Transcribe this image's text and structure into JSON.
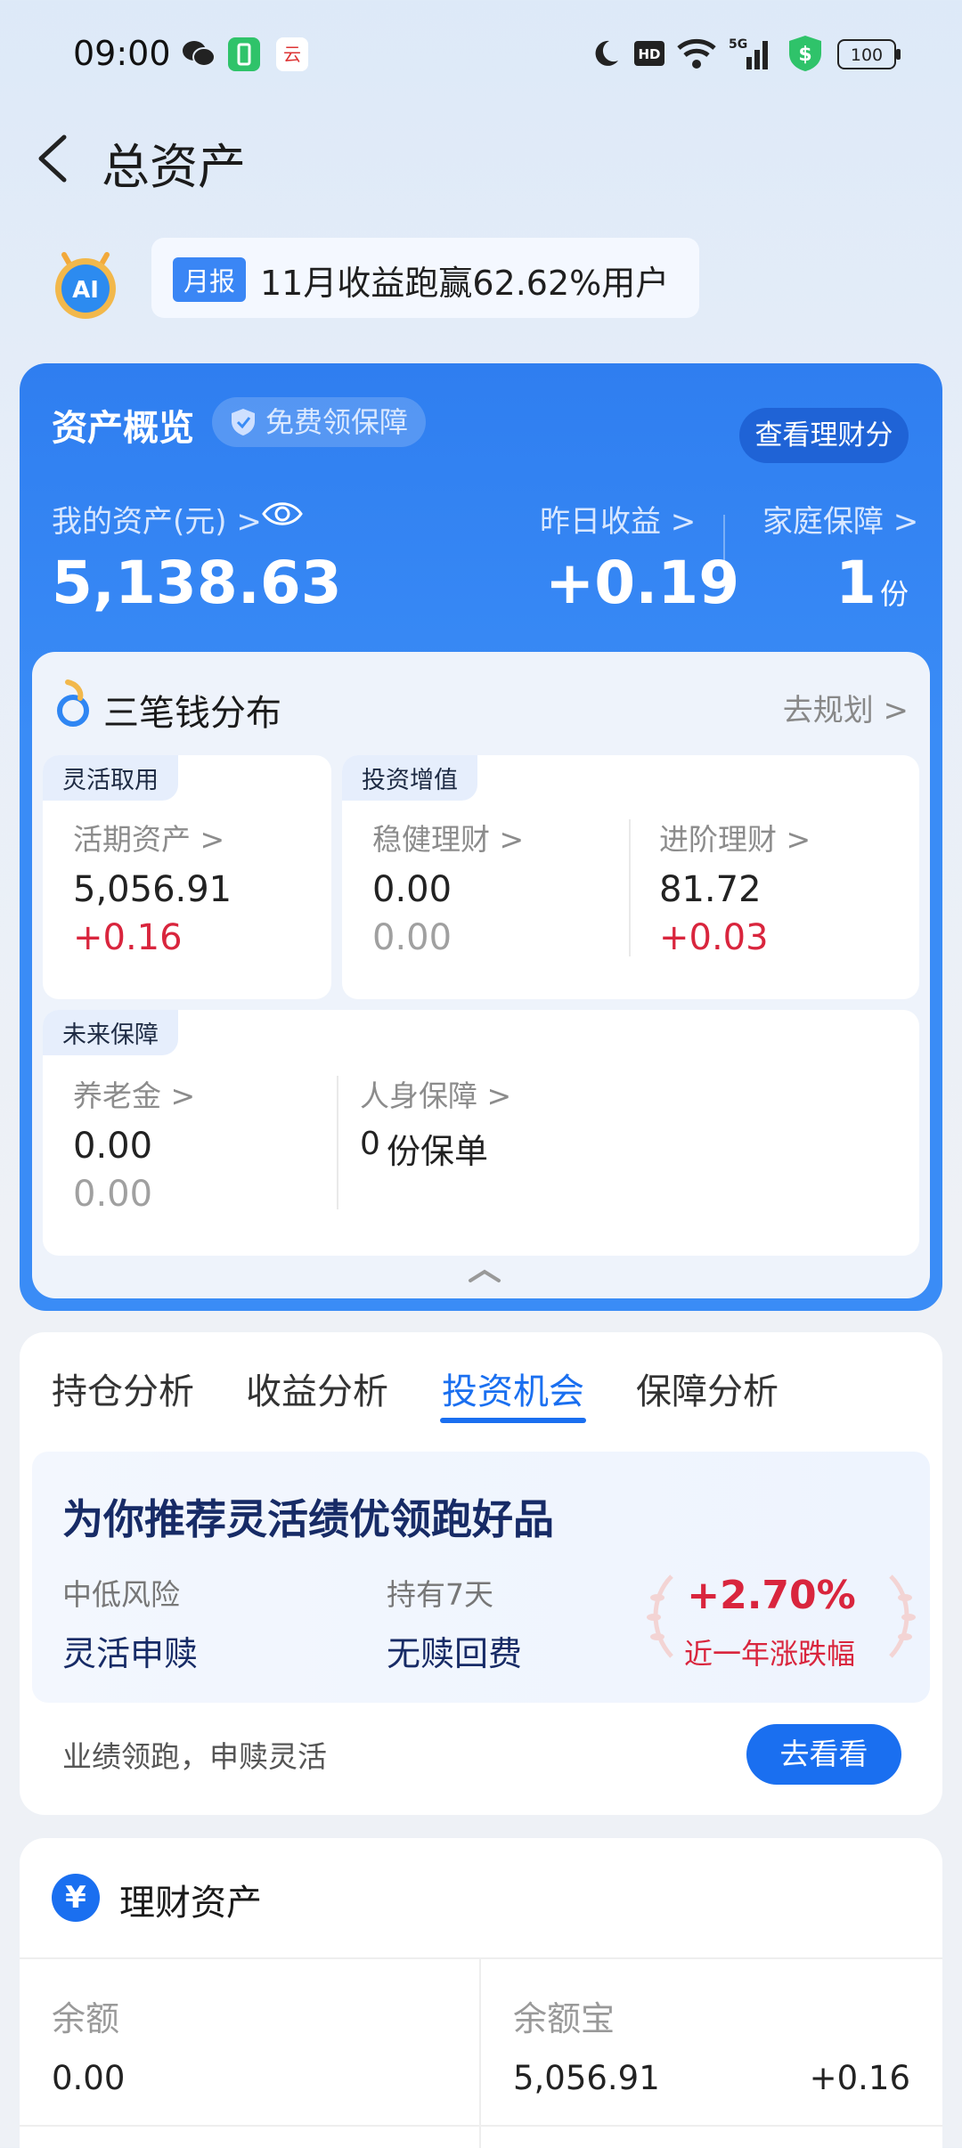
{
  "status_bar": {
    "time": "09:00",
    "battery": "100",
    "network": "5G"
  },
  "header": {
    "title": "总资产"
  },
  "ai_banner": {
    "tag": "月报",
    "text": "11月收益跑赢62.62%用户"
  },
  "overview": {
    "title": "资产概览",
    "badge": "免费领保障",
    "button": "查看理财分",
    "my_assets_label": "我的资产(元) >",
    "my_assets_value": "5,138.63",
    "yesterday_label": "昨日收益 >",
    "yesterday_value": "+0.19",
    "family_label": "家庭保障 >",
    "family_value": "1",
    "family_unit": "份"
  },
  "three_money": {
    "title": "三笔钱分布",
    "link": "去规划 >",
    "flexible": {
      "tag": "灵活取用",
      "label": "活期资产 >",
      "value": "5,056.91",
      "change": "+0.16"
    },
    "invest": {
      "tag": "投资增值",
      "steady": {
        "label": "稳健理财 >",
        "value": "0.00",
        "change": "0.00"
      },
      "advanced": {
        "label": "进阶理财 >",
        "value": "81.72",
        "change": "+0.03"
      }
    },
    "future": {
      "tag": "未来保障",
      "pension": {
        "label": "养老金 >",
        "value": "0.00",
        "change": "0.00"
      },
      "insurance": {
        "label": "人身保障 >",
        "count": "0",
        "unit": "份保单"
      }
    }
  },
  "tabs": [
    "持仓分析",
    "收益分析",
    "投资机会",
    "保障分析"
  ],
  "active_tab": "投资机会",
  "recommend": {
    "title": "为你推荐灵活绩优领跑好品",
    "col1_label": "中低风险",
    "col1_value": "灵活申赎",
    "col2_label": "持有7天",
    "col2_value": "无赎回费",
    "pct": "+2.70%",
    "pct_label": "近一年涨跌幅",
    "footer": "业绩领跑，申赎灵活",
    "button": "去看看"
  },
  "wealth": {
    "icon": "¥",
    "title": "理财资产",
    "balance_label": "余额",
    "balance_value": "0.00",
    "yuebao_label": "余额宝",
    "yuebao_value": "5,056.91",
    "yuebao_change": "+0.16"
  },
  "colors": {
    "accent": "#1a6ff0",
    "card_blue": "#3a8cf6",
    "gain_red": "#d9253d"
  }
}
